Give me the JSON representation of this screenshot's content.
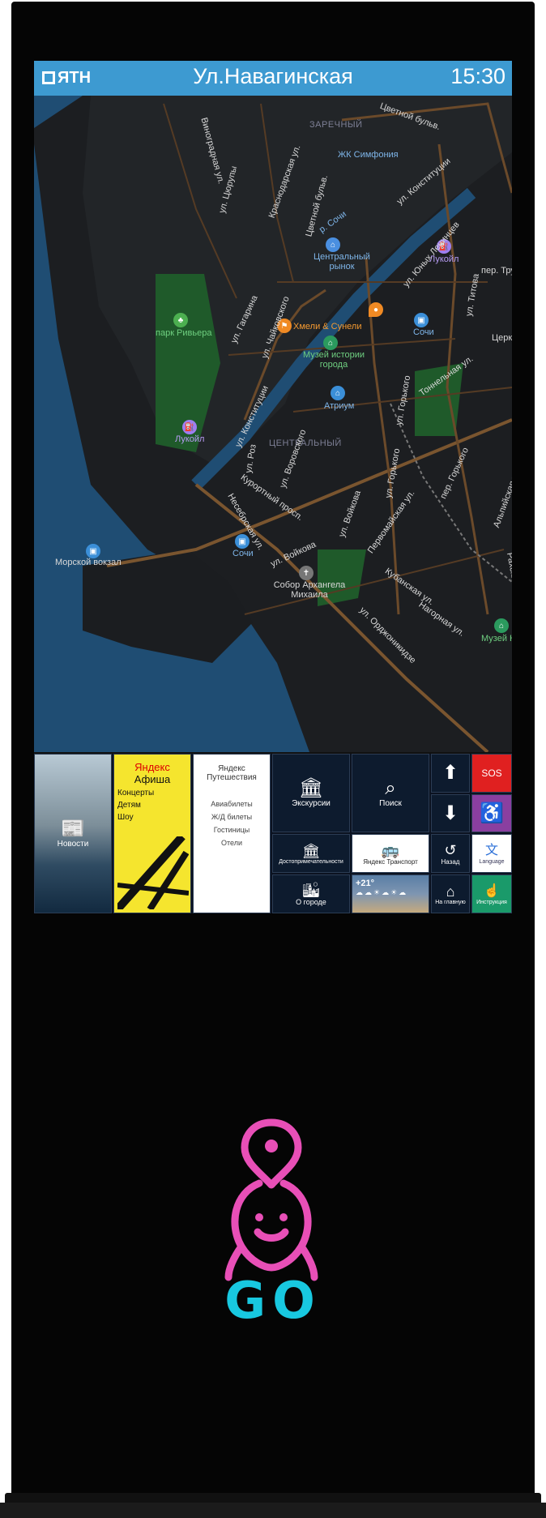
{
  "header": {
    "logo_text": "ЯТН",
    "street": "Ул.Навагинская",
    "time": "15:30"
  },
  "map": {
    "districts": [
      "ЗАРЕЧНЫЙ",
      "ЦЕНТРАЛЬНЫЙ"
    ],
    "places": [
      {
        "name": "Цветной бульв.",
        "kind": "street"
      },
      {
        "name": "ЖК Симфония",
        "kind": "poi"
      },
      {
        "name": "Центральный рынок",
        "kind": "poi"
      },
      {
        "name": "Лукойл",
        "kind": "fuel"
      },
      {
        "name": "парк Ривьера",
        "kind": "park"
      },
      {
        "name": "Хмели & Сунели",
        "kind": "food"
      },
      {
        "name": "Музей истории города",
        "kind": "museum"
      },
      {
        "name": "Сочи",
        "kind": "station"
      },
      {
        "name": "Атриум",
        "kind": "shop"
      },
      {
        "name": "Морской вокзал",
        "kind": "station"
      },
      {
        "name": "Собор Архангела Михаила",
        "kind": "church"
      },
      {
        "name": "Музей Н",
        "kind": "museum"
      }
    ],
    "streets": [
      "Виноградная ул.",
      "ул. Цюрупы",
      "Краснодарская ул.",
      "р. Сочи",
      "ул. Конституции",
      "ул. Гагарина",
      "ул. Чайковского",
      "ул. Роз",
      "ул. Воровского",
      "ул. Горького",
      "Курортный просп.",
      "Несебрская ул.",
      "ул. Войкова",
      "ул. Орджоникидзе",
      "Кубанская ул.",
      "Нагорная ул.",
      "ул. Титова",
      "Тоннельная ул.",
      "Альпийская ул.",
      "пер. Горького",
      "Рахский пер.",
      "ул. Юных Ленинцев",
      "Цветной бульв.",
      "Первомайская ул.",
      "пер. Тру",
      "Церк"
    ]
  },
  "tiles": {
    "news": "Новости",
    "afisha": {
      "brand_a": "Яндекс",
      "brand_b": "Афиша",
      "items": [
        "Концерты",
        "Детям",
        "Шоу"
      ]
    },
    "travel": {
      "brand": "Яндекс Путешествия",
      "items": [
        "Авиабилеты",
        "Ж/Д билеты",
        "Гостиницы",
        "Отели"
      ]
    },
    "excursions": "Экскурсии",
    "search": "Поиск",
    "sights": "Достопримечательности",
    "transport": "Яндекс Транспорт",
    "about": "О городе",
    "weather": "+21°",
    "back": "Назад",
    "home": "На главную",
    "sos": "SOS",
    "language": "Language",
    "instruction": "Инструкция"
  },
  "brand": {
    "go_text": "GO",
    "pink": "#e84fb7",
    "cyan": "#18c8e0"
  },
  "colors": {
    "header": "#3d9ad1",
    "sos": "#e02020",
    "accessibility": "#8a3fa0",
    "instruction": "#1a9a6a"
  }
}
